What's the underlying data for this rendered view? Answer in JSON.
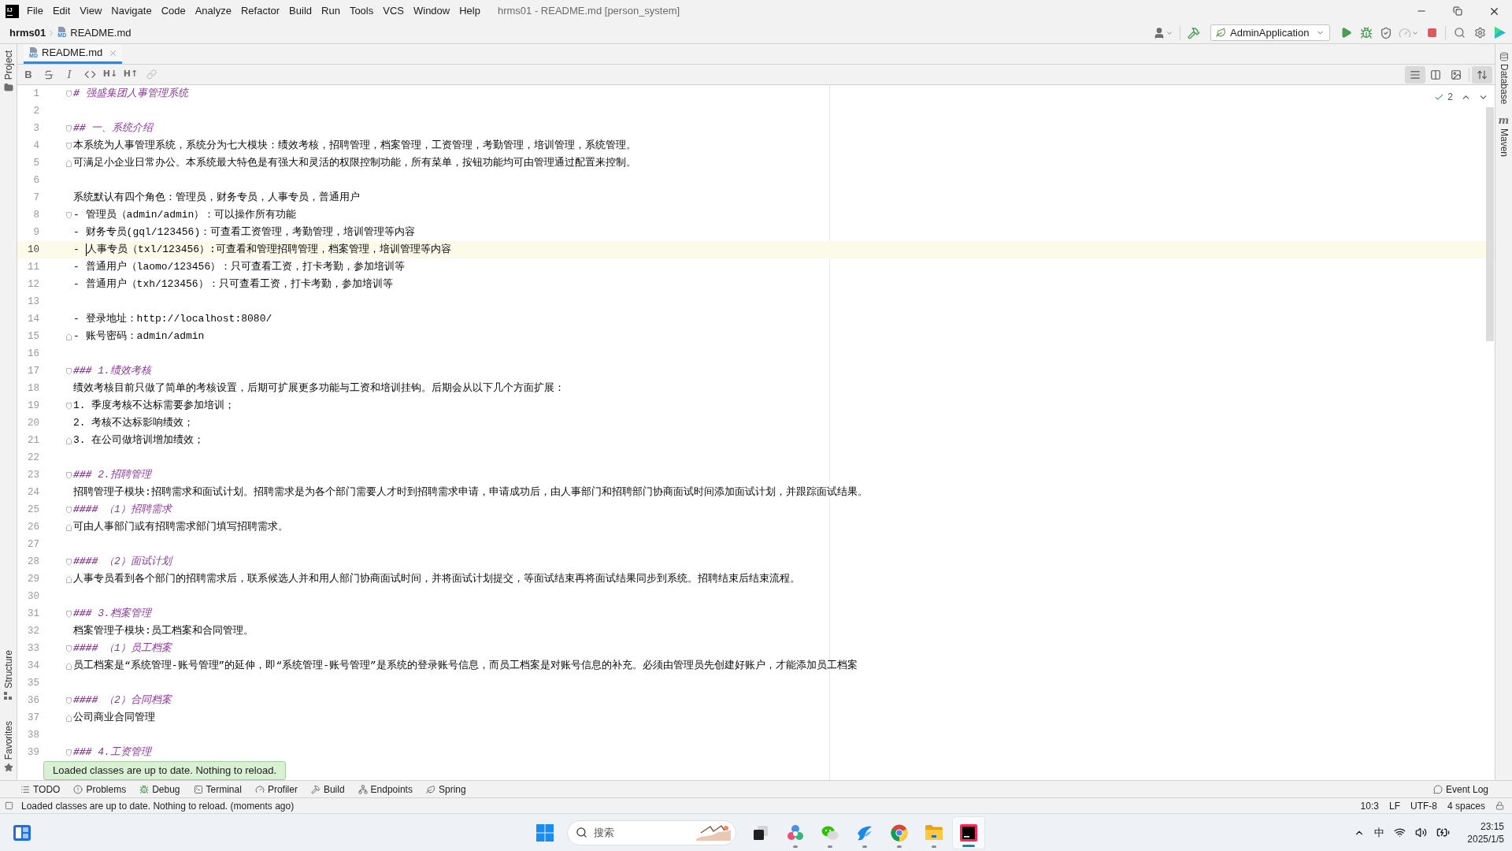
{
  "window": {
    "logo": "IJ",
    "menus": [
      "File",
      "Edit",
      "View",
      "Navigate",
      "Code",
      "Analyze",
      "Refactor",
      "Build",
      "Run",
      "Tools",
      "VCS",
      "Window",
      "Help"
    ],
    "title": "hrms01 - README.md [person_system]"
  },
  "navbar": {
    "project": "hrms01",
    "file": {
      "badge": "MD",
      "label": "README.md"
    },
    "toolbar_left": [
      {
        "kind": "user",
        "disabled": false
      },
      {
        "kind": "build",
        "disabled": false
      }
    ],
    "run_config": {
      "label": "AdminApplication"
    },
    "toolbar_right": [
      {
        "kind": "run",
        "disabled": false
      },
      {
        "kind": "debug",
        "disabled": false
      },
      {
        "kind": "coverage",
        "disabled": false
      },
      {
        "kind": "profile",
        "disabled": true
      },
      {
        "kind": "stop",
        "disabled": false
      }
    ],
    "toolbar_end": [
      {
        "kind": "search",
        "disabled": false
      },
      {
        "kind": "settings",
        "disabled": false
      },
      {
        "kind": "plugin",
        "disabled": false
      }
    ]
  },
  "left_strip": {
    "top": [
      {
        "kind": "project",
        "label": "Project"
      }
    ],
    "bottom": [
      {
        "kind": "structure",
        "label": "Structure"
      },
      {
        "kind": "favorites",
        "label": "Favorites"
      }
    ]
  },
  "right_strip": [
    {
      "kind": "database",
      "label": "Database"
    },
    {
      "kind": "maven",
      "label": "Maven",
      "glyph": "m"
    }
  ],
  "tabs": [
    {
      "label": "README.md",
      "badge": "MD",
      "selected": true
    }
  ],
  "markdown_toolbar": {
    "tools": [
      {
        "kind": "bold",
        "label": "B",
        "disabled": false
      },
      {
        "kind": "strikethrough",
        "disabled": false
      },
      {
        "kind": "italic",
        "label": "I",
        "disabled": false
      },
      {
        "kind": "code",
        "disabled": false
      },
      {
        "kind": "text",
        "label": "H↓",
        "disabled": false
      },
      {
        "kind": "text",
        "label": "H↑",
        "disabled": false
      },
      {
        "kind": "link",
        "disabled": true
      }
    ],
    "view_modes": [
      {
        "kind": "editor",
        "selected": true
      },
      {
        "kind": "split",
        "selected": false
      },
      {
        "kind": "preview",
        "selected": false
      }
    ],
    "scroll_sync": {
      "on": true
    }
  },
  "editor": {
    "inspection": {
      "count": "2"
    },
    "lines": [
      {
        "number": "1",
        "kind": "heading",
        "text": "**#** 强盛集团人事管理系统",
        "fold_start": true,
        "fold_end": false,
        "current": false
      },
      {
        "number": "2",
        "kind": "blank",
        "fold_start": false,
        "fold_end": false,
        "current": false
      },
      {
        "number": "3",
        "kind": "heading",
        "text": "**##** 一、系统介绍",
        "fold_start": true,
        "fold_end": false,
        "current": false
      },
      {
        "number": "4",
        "kind": "text",
        "text": "本系统为人事管理系统，系统分为七大模块：绩效考核，招聘管理，档案管理，工资管理，考勤管理，培训管理，系统管理。",
        "fold_start": true,
        "fold_end": false,
        "current": false
      },
      {
        "number": "5",
        "kind": "text",
        "text": "可满足小企业日常办公。本系统最大特色是有强大和灵活的权限控制功能，所有菜单，按钮功能均可由管理通过配置来控制。",
        "fold_start": false,
        "fold_end": true,
        "current": false
      },
      {
        "number": "6",
        "kind": "blank",
        "fold_start": false,
        "fold_end": false,
        "current": false
      },
      {
        "number": "7",
        "kind": "text",
        "text": "系统默认有四个角色：管理员，财务专员，人事专员，普通用户",
        "fold_start": false,
        "fold_end": false,
        "current": false
      },
      {
        "number": "8",
        "kind": "text",
        "text": "- 管理员（admin/admin）：可以操作所有功能",
        "fold_start": true,
        "fold_end": false,
        "current": false
      },
      {
        "number": "9",
        "kind": "text",
        "text": "- 财务专员(gql/123456)：可查看工资管理，考勤管理，培训管理等内容",
        "fold_start": false,
        "fold_end": false,
        "current": false
      },
      {
        "number": "10",
        "kind": "text",
        "text": "- ",
        "text_after_caret": "人事专员（txl/123456）:可查看和管理招聘管理，档案管理，培训管理等内容",
        "fold_start": false,
        "fold_end": false,
        "current": true
      },
      {
        "number": "11",
        "kind": "text",
        "text": "- 普通用户（laomo/123456）：只可查看工资，打卡考勤，参加培训等",
        "fold_start": false,
        "fold_end": false,
        "current": false
      },
      {
        "number": "12",
        "kind": "text",
        "text": "- 普通用户（txh/123456）：只可查看工资，打卡考勤，参加培训等",
        "fold_start": false,
        "fold_end": false,
        "current": false
      },
      {
        "number": "13",
        "kind": "blank",
        "fold_start": false,
        "fold_end": false,
        "current": false
      },
      {
        "number": "14",
        "kind": "text",
        "text": "- 登录地址：http://localhost:8080/",
        "fold_start": false,
        "fold_end": false,
        "current": false
      },
      {
        "number": "15",
        "kind": "text",
        "text": "- 账号密码：admin/admin",
        "fold_start": false,
        "fold_end": true,
        "current": false
      },
      {
        "number": "16",
        "kind": "blank",
        "fold_start": false,
        "fold_end": false,
        "current": false
      },
      {
        "number": "17",
        "kind": "heading",
        "text": "**###** 1.绩效考核",
        "fold_start": true,
        "fold_end": false,
        "current": false
      },
      {
        "number": "18",
        "kind": "text",
        "text": "绩效考核目前只做了简单的考核设置，后期可扩展更多功能与工资和培训挂钩。后期会从以下几个方面扩展：",
        "fold_start": false,
        "fold_end": false,
        "current": false
      },
      {
        "number": "19",
        "kind": "text",
        "text": "1. 季度考核不达标需要参加培训；",
        "fold_start": true,
        "fold_end": false,
        "current": false
      },
      {
        "number": "20",
        "kind": "text",
        "text": "2. 考核不达标影响绩效；",
        "fold_start": false,
        "fold_end": false,
        "current": false
      },
      {
        "number": "21",
        "kind": "text",
        "text": "3. 在公司做培训增加绩效；",
        "fold_start": false,
        "fold_end": true,
        "current": false
      },
      {
        "number": "22",
        "kind": "blank",
        "fold_start": false,
        "fold_end": false,
        "current": false
      },
      {
        "number": "23",
        "kind": "heading",
        "text": "**###** 2.招聘管理",
        "fold_start": true,
        "fold_end": false,
        "current": false
      },
      {
        "number": "24",
        "kind": "text",
        "text": "招聘管理子模块:招聘需求和面试计划。招聘需求是为各个部门需要人才时到招聘需求申请，申请成功后，由人事部门和招聘部门协商面试时间添加面试计划，并跟踪面试结果。",
        "fold_start": false,
        "fold_end": false,
        "current": false
      },
      {
        "number": "25",
        "kind": "heading",
        "text": "**####** （1）招聘需求",
        "fold_start": true,
        "fold_end": false,
        "current": false
      },
      {
        "number": "26",
        "kind": "text",
        "text": "可由人事部门或有招聘需求部门填写招聘需求。",
        "fold_start": false,
        "fold_end": true,
        "current": false
      },
      {
        "number": "27",
        "kind": "blank",
        "fold_start": false,
        "fold_end": false,
        "current": false
      },
      {
        "number": "28",
        "kind": "heading",
        "text": "**####** （2）面试计划",
        "fold_start": true,
        "fold_end": false,
        "current": false
      },
      {
        "number": "29",
        "kind": "text",
        "text": "人事专员看到各个部门的招聘需求后，联系候选人并和用人部门协商面试时间，并将面试计划提交，等面试结束再将面试结果同步到系统。招聘结束后结束流程。",
        "fold_start": false,
        "fold_end": true,
        "current": false
      },
      {
        "number": "30",
        "kind": "blank",
        "fold_start": false,
        "fold_end": false,
        "current": false
      },
      {
        "number": "31",
        "kind": "heading",
        "text": "**###** 3.档案管理",
        "fold_start": true,
        "fold_end": false,
        "current": false
      },
      {
        "number": "32",
        "kind": "text",
        "text": "档案管理子模块:员工档案和合同管理。",
        "fold_start": false,
        "fold_end": false,
        "current": false
      },
      {
        "number": "33",
        "kind": "heading",
        "text": "**####** （1）员工档案",
        "fold_start": true,
        "fold_end": false,
        "current": false
      },
      {
        "number": "34",
        "kind": "text",
        "text": "员工档案是“系统管理-账号管理”的延伸，即“系统管理-账号管理”是系统的登录账号信息，而员工档案是对账号信息的补充。必须由管理员先创建好账户，才能添加员工档案",
        "fold_start": false,
        "fold_end": true,
        "current": false
      },
      {
        "number": "35",
        "kind": "blank",
        "fold_start": false,
        "fold_end": false,
        "current": false
      },
      {
        "number": "36",
        "kind": "heading",
        "text": "**####** （2）合同档案",
        "fold_start": true,
        "fold_end": false,
        "current": false
      },
      {
        "number": "37",
        "kind": "text",
        "text": "公司商业合同管理",
        "fold_start": false,
        "fold_end": true,
        "current": false
      },
      {
        "number": "38",
        "kind": "blank",
        "fold_start": false,
        "fold_end": false,
        "current": false
      },
      {
        "number": "39",
        "kind": "heading",
        "text": "**###** 4.工资管理",
        "fold_start": true,
        "fold_end": false,
        "current": false
      }
    ],
    "toast": "Loaded classes are up to date. Nothing to reload."
  },
  "tool_windows": [
    {
      "kind": "todo",
      "label": "TODO"
    },
    {
      "kind": "problems",
      "label": "Problems"
    },
    {
      "kind": "debug",
      "label": "Debug"
    },
    {
      "kind": "terminal",
      "label": "Terminal"
    },
    {
      "kind": "profiler",
      "label": "Profiler"
    },
    {
      "kind": "build",
      "label": "Build"
    },
    {
      "kind": "endpoints",
      "label": "Endpoints"
    },
    {
      "kind": "spring",
      "label": "Spring"
    }
  ],
  "event_log": {
    "label": "Event Log"
  },
  "status_bar": {
    "message": "Loaded classes are up to date. Nothing to reload. (moments ago)",
    "position": "10:3",
    "line_separator": "LF",
    "encoding": "UTF-8",
    "indent": "4 spaces"
  },
  "taskbar": {
    "search": {
      "placeholder": "搜索"
    },
    "apps": [
      {
        "kind": "dark_square",
        "running": false,
        "selected": false
      },
      {
        "kind": "circles",
        "running": true,
        "selected": false
      },
      {
        "kind": "chat",
        "running": true,
        "selected": false
      },
      {
        "kind": "wing",
        "running": true,
        "selected": false
      },
      {
        "kind": "browser",
        "running": true,
        "selected": false
      },
      {
        "kind": "folder",
        "running": true,
        "selected": false
      },
      {
        "kind": "ide",
        "running": true,
        "selected": true
      }
    ],
    "tray": {
      "ime": "中",
      "time": "23:15",
      "date": "2025/1/5"
    }
  }
}
